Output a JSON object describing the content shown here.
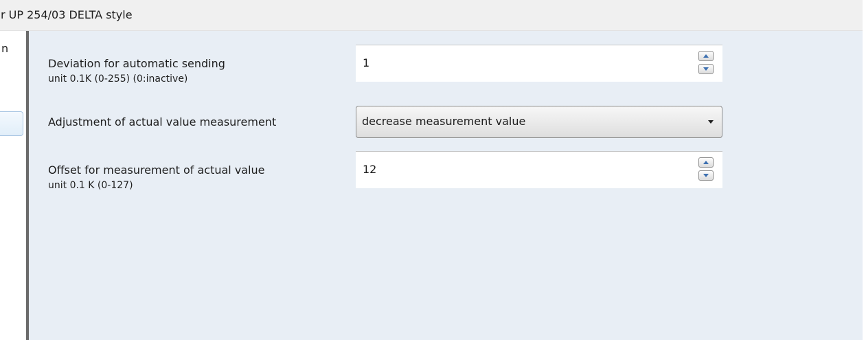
{
  "window": {
    "title": "r UP 254/03 DELTA style"
  },
  "left_panel": {
    "clipped_text": "n"
  },
  "parameters": [
    {
      "label_line1": "Deviation for automatic sending",
      "label_line2": "unit 0.1K  (0-255)  (0:inactive)",
      "control": "spinbox",
      "value": "1"
    },
    {
      "label_line1": "Adjustment of actual value measurement",
      "control": "dropdown",
      "value": "decrease measurement value"
    },
    {
      "label_line1": "Offset for measurement of actual value",
      "label_line2": "unit 0.1 K (0-127)",
      "control": "spinbox",
      "value": "12"
    }
  ],
  "icons": {
    "spin_up": "triangle-up-icon",
    "spin_down": "triangle-down-icon",
    "dropdown": "chevron-down-icon"
  },
  "colors": {
    "content_background": "#e8eef5",
    "titlebar_background": "#f0f0f0",
    "splitter": "#6a6a6a",
    "spin_arrow": "#3c6fb0"
  }
}
